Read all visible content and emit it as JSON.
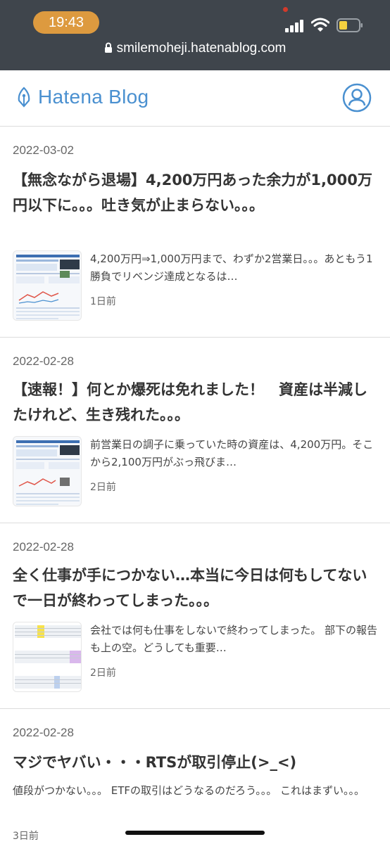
{
  "status": {
    "time": "19:43",
    "url": "smilemoheji.hatenablog.com"
  },
  "header": {
    "logo_text": "Hatena Blog",
    "brand_color": "#4a90d0"
  },
  "entries": [
    {
      "date": "2022-03-02",
      "title": "【無念ながら退場】4,200万円あった余力が1,000万円以下に。。。吐き気が止まらない。。。",
      "excerpt": "4,200万円⇒1,000万円まで、わずか2営業日。。。あともう1勝負でリベンジ達成となるは…",
      "ago": "1日前"
    },
    {
      "date": "2022-02-28",
      "title": "【速報！】何とか爆死は免れました！　資産は半減したけれど、生き残れた。。。",
      "excerpt": "前営業日の調子に乗っていた時の資産は、4,200万円。そこから2,100万円がぶっ飛びま…",
      "ago": "2日前"
    },
    {
      "date": "2022-02-28",
      "title": "全く仕事が手につかない…本当に今日は何もしてないで一日が終わってしまった。。。",
      "excerpt": "会社では何も仕事をしないで終わってしまった。 部下の報告も上の空。どうしても重要…",
      "ago": "2日前"
    },
    {
      "date": "2022-02-28",
      "title": "マジでヤバい・・・RTSが取引停止(>_<)",
      "excerpt": "値段がつかない。。。 ETFの取引はどうなるのだろう。。。 これはまずい。。。",
      "ago": "3日前"
    }
  ]
}
